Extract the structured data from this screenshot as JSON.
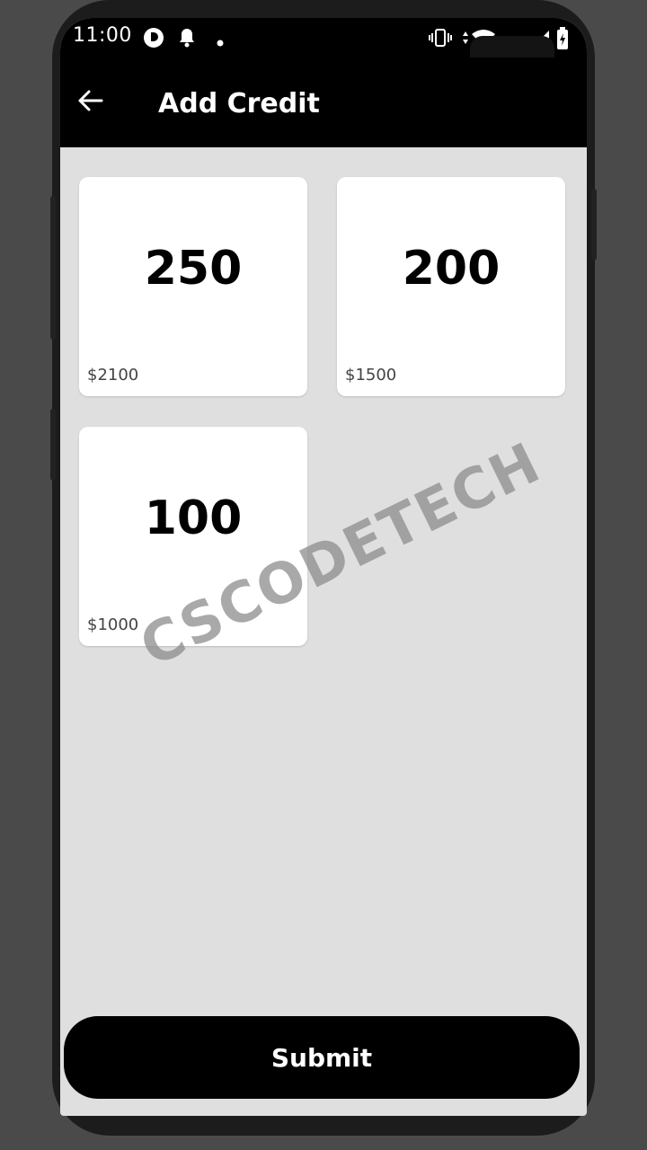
{
  "status_bar": {
    "time": "11:00"
  },
  "app_bar": {
    "title": "Add Credit",
    "back_icon": "arrow-left-icon"
  },
  "credit_packages": [
    {
      "amount": "250",
      "price": "$2100"
    },
    {
      "amount": "200",
      "price": "$1500"
    },
    {
      "amount": "100",
      "price": "$1000"
    }
  ],
  "submit_label": "Submit",
  "watermark": "CSCODETECH",
  "colors": {
    "app_bar_bg": "#000000",
    "screen_bg": "#e0dfe0",
    "card_bg": "#ffffff",
    "button_bg": "#000000"
  }
}
